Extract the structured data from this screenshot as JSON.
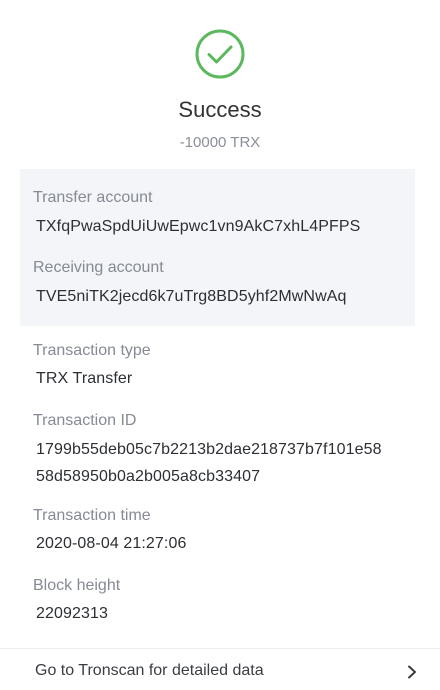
{
  "status": {
    "title": "Success",
    "amount": "-10000 TRX",
    "icon": "check-circle-icon",
    "accent_color": "#5cb85c"
  },
  "accounts": {
    "transfer_label": "Transfer account",
    "transfer_value": "TXfqPwaSpdUiUwEpwc1vn9AkC7xhL4PFPS",
    "receiving_label": "Receiving account",
    "receiving_value": "TVE5niTK2jecd6k7uTrg8BD5yhf2MwNwAq"
  },
  "details": {
    "type_label": "Transaction type",
    "type_value": "TRX Transfer",
    "id_label": "Transaction ID",
    "id_value_line1": "1799b55deb05c7b2213b2dae218737b7f101e58",
    "id_value_line2": "58d58950b0a2b005a8cb33407",
    "time_label": "Transaction time",
    "time_value": "2020-08-04 21:27:06",
    "block_label": "Block height",
    "block_value": "22092313"
  },
  "footer": {
    "link_label": "Go to Tronscan for detailed data",
    "icon": "chevron-right-icon"
  }
}
